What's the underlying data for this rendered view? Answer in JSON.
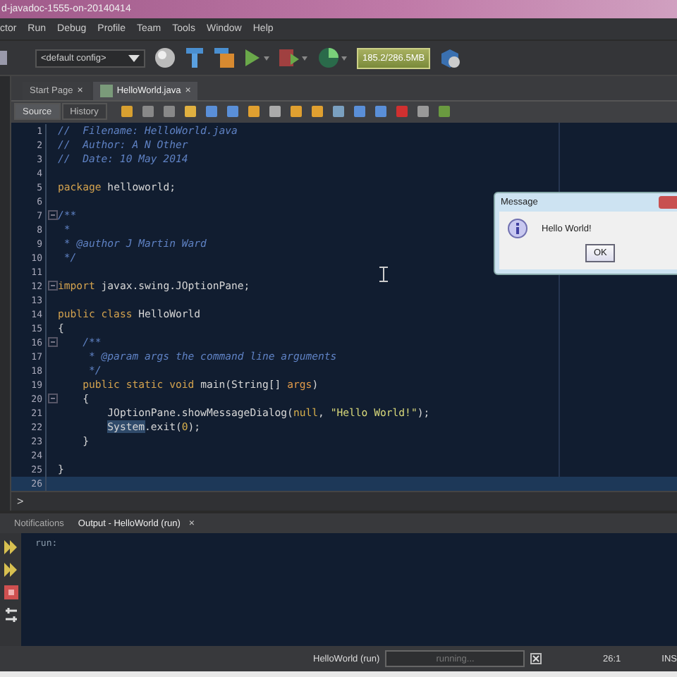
{
  "window": {
    "title": "d-javadoc-1555-on-20140414"
  },
  "menu": [
    "ctor",
    "Run",
    "Debug",
    "Profile",
    "Team",
    "Tools",
    "Window",
    "Help"
  ],
  "toolbar": {
    "config": "<default config>",
    "memory": "185.2/286.5MB"
  },
  "editor_tabs": [
    {
      "label": "Start Page",
      "selected": false,
      "close": "×"
    },
    {
      "label": "HelloWorld.java",
      "selected": true,
      "close": "×"
    }
  ],
  "view_tabs": [
    {
      "label": "Source",
      "selected": true
    },
    {
      "label": "History",
      "selected": false
    }
  ],
  "code": [
    {
      "number": "1",
      "foldable": false,
      "current": false,
      "tokens": [
        {
          "kind": "comment",
          "text": "//  Filename: HelloWorld.java"
        }
      ]
    },
    {
      "number": "2",
      "foldable": false,
      "current": false,
      "tokens": [
        {
          "kind": "comment",
          "text": "//  Author: A N Other"
        }
      ]
    },
    {
      "number": "3",
      "foldable": false,
      "current": false,
      "tokens": [
        {
          "kind": "comment",
          "text": "//  Date: 10 May 2014"
        }
      ]
    },
    {
      "number": "4",
      "foldable": false,
      "current": false
    },
    {
      "number": "5",
      "foldable": false,
      "current": false,
      "tokens": [
        {
          "kind": "keyword",
          "text": "package"
        },
        {
          "kind": "plain",
          "text": " helloworld;"
        }
      ]
    },
    {
      "number": "6",
      "foldable": false,
      "current": false
    },
    {
      "number": "7",
      "foldable": true,
      "current": false,
      "tokens": [
        {
          "kind": "comment",
          "text": "/**"
        }
      ]
    },
    {
      "number": "8",
      "foldable": false,
      "current": false,
      "tokens": [
        {
          "kind": "comment",
          "text": " *"
        }
      ]
    },
    {
      "number": "9",
      "foldable": false,
      "current": false,
      "tokens": [
        {
          "kind": "comment",
          "text": " * @author J Martin Ward"
        }
      ]
    },
    {
      "number": "10",
      "foldable": false,
      "current": false,
      "tokens": [
        {
          "kind": "comment",
          "text": " */"
        }
      ]
    },
    {
      "number": "11",
      "foldable": false,
      "current": false
    },
    {
      "number": "12",
      "foldable": true,
      "current": false,
      "tokens": [
        {
          "kind": "keyword",
          "text": "import"
        },
        {
          "kind": "plain",
          "text": " javax.swing.JOptionPane;"
        }
      ]
    },
    {
      "number": "13",
      "foldable": false,
      "current": false
    },
    {
      "number": "14",
      "foldable": false,
      "current": false,
      "tokens": [
        {
          "kind": "keyword",
          "text": "public"
        },
        {
          "kind": "keyword",
          "text": " class"
        },
        {
          "kind": "plain",
          "text": " HelloWorld"
        }
      ]
    },
    {
      "number": "15",
      "foldable": false,
      "current": false,
      "tokens": [
        {
          "kind": "plain",
          "text": "{"
        }
      ]
    },
    {
      "number": "16",
      "foldable": true,
      "current": false,
      "tokens": [
        {
          "kind": "comment",
          "text": "    /**"
        }
      ]
    },
    {
      "number": "17",
      "foldable": false,
      "current": false,
      "tokens": [
        {
          "kind": "comment",
          "text": "     * @param args the command line arguments"
        }
      ]
    },
    {
      "number": "18",
      "foldable": false,
      "current": false,
      "tokens": [
        {
          "kind": "comment",
          "text": "     */"
        }
      ]
    },
    {
      "number": "19",
      "foldable": false,
      "current": false,
      "tokens": [
        {
          "kind": "keyword",
          "text": "    public"
        },
        {
          "kind": "keyword",
          "text": " static"
        },
        {
          "kind": "keyword",
          "text": " void"
        },
        {
          "kind": "plain",
          "text": " main(String[] "
        },
        {
          "kind": "param",
          "text": "args"
        },
        {
          "kind": "plain",
          "text": ")"
        }
      ]
    },
    {
      "number": "20",
      "foldable": true,
      "current": false,
      "tokens": [
        {
          "kind": "plain",
          "text": "    {"
        }
      ]
    },
    {
      "number": "21",
      "foldable": false,
      "current": false,
      "tokens": [
        {
          "kind": "plain",
          "text": "        JOptionPane.showMessageDialog("
        },
        {
          "kind": "literal",
          "text": "null"
        },
        {
          "kind": "plain",
          "text": ", "
        },
        {
          "kind": "string",
          "text": "\"Hello World!\""
        },
        {
          "kind": "plain",
          "text": ");"
        }
      ]
    },
    {
      "number": "22",
      "foldable": false,
      "current": false,
      "tokens": [
        {
          "kind": "marked",
          "text": "        System"
        },
        {
          "kind": "plain",
          "text": ".exit("
        },
        {
          "kind": "literal",
          "text": "0"
        },
        {
          "kind": "plain",
          "text": ");"
        }
      ]
    },
    {
      "number": "23",
      "foldable": false,
      "current": false,
      "tokens": [
        {
          "kind": "plain",
          "text": "    }"
        }
      ]
    },
    {
      "number": "24",
      "foldable": false,
      "current": false
    },
    {
      "number": "25",
      "foldable": false,
      "current": false,
      "tokens": [
        {
          "kind": "plain",
          "text": "}"
        }
      ]
    },
    {
      "number": "26",
      "foldable": false,
      "current": true
    }
  ],
  "breadcrumb": ">",
  "output_tabs": [
    {
      "label": "Notifications",
      "selected": false
    },
    {
      "label": "Output - HelloWorld (run)",
      "selected": true,
      "close": "×"
    }
  ],
  "output": {
    "text": "run:"
  },
  "status_bar": {
    "task": "HelloWorld (run)",
    "progress": "running...",
    "position": "26:1",
    "mode": "INS"
  },
  "dialog": {
    "title": "Message",
    "message": "Hello World!",
    "button": "OK"
  }
}
